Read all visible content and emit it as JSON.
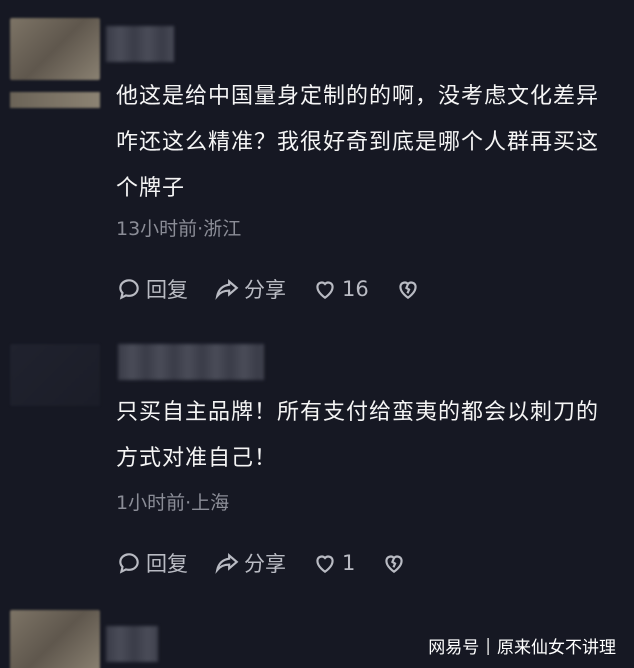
{
  "comments": [
    {
      "text": "他这是给中国量身定制的的啊，没考虑文化差异咋还这么精准？我很好奇到底是哪个人群再买这个牌子",
      "meta": "13小时前·浙江",
      "reply_label": "回复",
      "share_label": "分享",
      "like_count": "16"
    },
    {
      "text": "只买自主品牌！所有支付给蛮夷的都会以刺刀的方式对准自己！",
      "meta": "1小时前·上海",
      "reply_label": "回复",
      "share_label": "分享",
      "like_count": "1"
    }
  ],
  "watermark": {
    "brand": "网易号",
    "separator": "|",
    "author": "原来仙女不讲理"
  },
  "icons": {
    "reply": "reply-bubble-icon",
    "share": "share-arrow-icon",
    "like": "heart-icon",
    "dislike": "broken-heart-icon"
  },
  "colors": {
    "background": "#161823",
    "text": "#f5f5f5",
    "meta": "#8b8d97",
    "actions": "#b9bbc3"
  }
}
